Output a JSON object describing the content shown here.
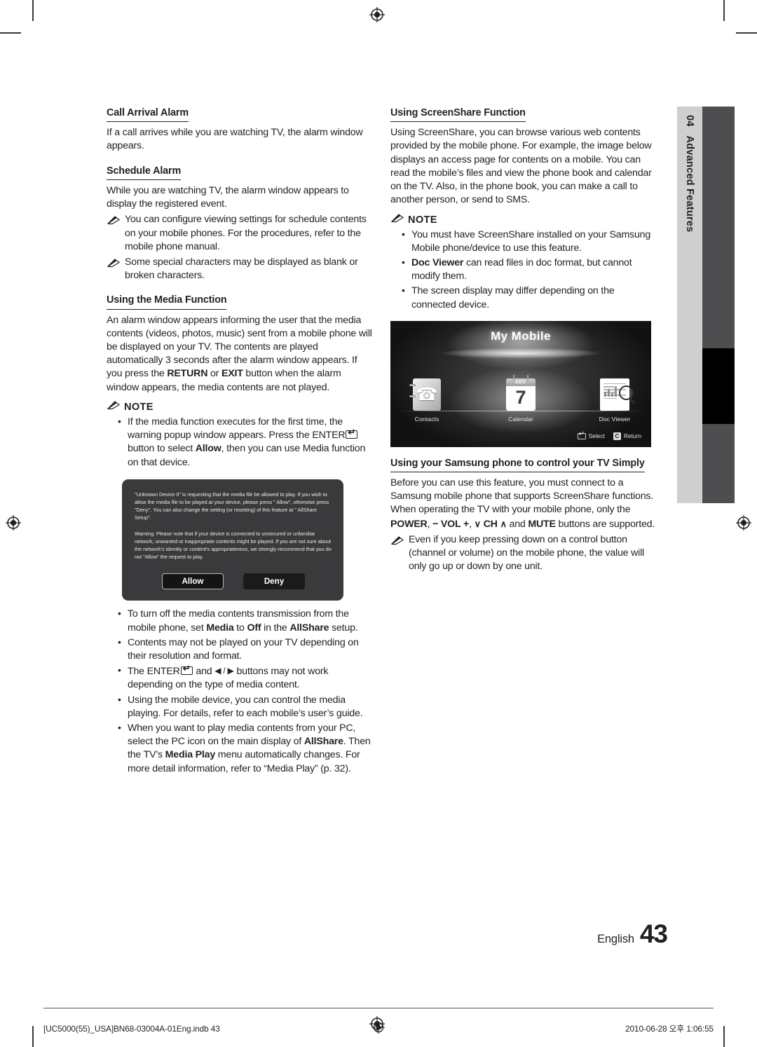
{
  "chapter_tab": {
    "number": "04",
    "title": "Advanced Features"
  },
  "left_column": {
    "call_arrival": {
      "heading": "Call Arrival Alarm",
      "body": "If a call arrives while you are watching TV, the alarm window appears."
    },
    "schedule_alarm": {
      "heading": "Schedule Alarm",
      "body": "While you are watching TV, the alarm window appears to display the registered event.",
      "notes": [
        "You can configure viewing settings for schedule contents on your mobile phones. For the procedures, refer to the mobile phone manual.",
        "Some special characters may be displayed as blank or broken characters."
      ]
    },
    "media_function": {
      "heading": "Using the Media Function",
      "body_1": "An alarm window appears informing the user that the media contents (videos, photos, music) sent from a mobile phone will be displayed on your TV. The contents are played automatically 3 seconds after the alarm window appears. If you press the ",
      "body_key_1": "RETURN",
      "body_2": " or ",
      "body_key_2": "EXIT",
      "body_3": " button when the alarm window appears, the media contents are not played.",
      "note_label": "NOTE",
      "note_first": {
        "part_1": "If the media function executes for the first time, the warning popup window appears. Press the ",
        "key": "ENTER",
        "part_2": " button to select ",
        "bold": "Allow",
        "part_3": ", then you can use Media function on that device."
      },
      "bullets_after": [
        {
          "part_1": "To turn off the media contents transmission from the mobile phone, set ",
          "bold_1": "Media",
          "part_2": " to ",
          "bold_2": "Off",
          "part_3": " in the ",
          "bold_3": "AllShare",
          "part_4": " setup."
        },
        {
          "text": "Contents may not be played on your TV depending on their resolution and format."
        },
        {
          "prefix": "The ",
          "key": "ENTER",
          "middle": " and ",
          "arrows": "◀ / ▶",
          "suffix": " buttons may not work depending on the type of media content."
        },
        {
          "text": "Using the mobile device, you can control the media playing. For details, refer to each mobile’s user’s guide."
        },
        {
          "part_1": "When you want to play media contents from your PC, select the PC icon on the main display of ",
          "bold_1": "AllShare",
          "part_2": ". Then the TV’s ",
          "bold_2": "Media Play",
          "part_3": " menu automatically changes. For more detail information, refer to “Media Play” (p. 32)."
        }
      ]
    },
    "dialog": {
      "paragraph_1": "\"Unknown Device 0\" is requesting that the media file be allowed to play. If you wish to allow the media file to be played at your device, please press \" Allow\", otherwise press \"Deny\". You can also change the setting (or resetting) of this feature at \" AllShare Setup\".",
      "paragraph_2": "Warning: Please note that if your device is connected to unsecured or unfamiliar network, unwanted or inappropriate contents might be played. If you are not sure about the network's identity or content's appropriateness, we strongly recommend that you do not \"Allow\" the request to play.",
      "allow_label": "Allow",
      "deny_label": "Deny"
    }
  },
  "right_column": {
    "screenshare": {
      "heading": "Using ScreenShare Function",
      "body": "Using ScreenShare, you can browse various web contents provided by the mobile phone. For example, the image below displays an access page for contents on a mobile. You can read the mobile’s files and view the phone book and calendar on the TV. Also, in the phone book, you can make a call to another person, or send to SMS.",
      "note_label": "NOTE",
      "bullets": [
        {
          "text": "You must have ScreenShare installed on your Samsung Mobile phone/device to use this feature."
        },
        {
          "bold": "Doc Viewer",
          "text": " can read files in doc format, but cannot modify them."
        },
        {
          "text": "The screen display may differ depending on the connected device."
        }
      ]
    },
    "tv_screen": {
      "title": "My Mobile",
      "items": [
        {
          "caption": "Contacts",
          "icon": "phone-icon"
        },
        {
          "caption": "Calendar",
          "icon": "calendar-icon",
          "month": "DEC",
          "day": "7"
        },
        {
          "caption": "Doc Viewer",
          "icon": "document-magnifier-icon"
        }
      ],
      "hints": [
        {
          "key": "enter-key-icon",
          "label": "Select"
        },
        {
          "key": "C",
          "label": "Return"
        }
      ]
    },
    "control_tv": {
      "heading": "Using your Samsung phone to control your TV Simply",
      "body_1": "Before you can use this feature, you must connect to a Samsung mobile phone that supports ScreenShare functions. When operating the TV with your mobile phone, only the ",
      "key_power": "POWER",
      "sep_1": ", ",
      "key_vol": "− VOL +",
      "sep_2": ", ",
      "key_ch_down": "∨",
      "key_ch": " CH ",
      "key_ch_up": "∧",
      "sep_3": " and ",
      "key_mute": "MUTE",
      "body_2": " buttons are supported.",
      "note": "Even if you keep pressing down on a control button (channel or volume) on the mobile phone, the value will only go up or down by one unit."
    }
  },
  "page_number": {
    "language": "English",
    "number": "43"
  },
  "footer": {
    "file": "[UC5000(55)_USA]BN68-03004A-01Eng.indb   43",
    "timestamp": "2010-06-28   오후 1:06:55"
  }
}
